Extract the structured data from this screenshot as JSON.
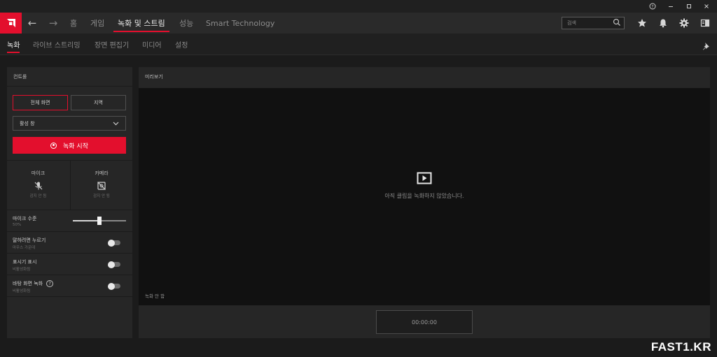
{
  "titlebar": {
    "controls": [
      "help-icon",
      "minimize-icon",
      "maximize-icon",
      "close-icon"
    ]
  },
  "topnav": {
    "home": "홈",
    "items": [
      "게임",
      "녹화 및 스트림",
      "성능",
      "Smart Technology"
    ],
    "active_index": 1,
    "search_placeholder": "검색",
    "tools": [
      "star-icon",
      "bell-icon",
      "gear-icon",
      "panel-icon"
    ]
  },
  "subnav": {
    "items": [
      "녹화",
      "라이브 스트리밍",
      "장면 편집기",
      "미디어",
      "설정"
    ],
    "active_index": 0
  },
  "left_panel": {
    "header": "컨트롤",
    "mode_full": "전체 화면",
    "mode_region": "지역",
    "active_mode": "전체 화면",
    "window_select": "활성 창",
    "record_button": "녹화 시작",
    "mic": {
      "label": "마이크",
      "status": "감지 안 됨"
    },
    "camera": {
      "label": "카메라",
      "status": "감지 안 됨"
    },
    "mic_level": {
      "label": "마이크 수준",
      "value_text": "50%",
      "value": 0.5
    },
    "push_to_talk": {
      "label": "말하려면 누르기",
      "sub": "마우스 가운데",
      "on": false
    },
    "show_indicator": {
      "label": "표시기 표시",
      "sub": "비활성화됨",
      "on": false
    },
    "desktop_record": {
      "label": "바탕 화면 녹화",
      "sub": "비활성화됨",
      "on": false
    }
  },
  "preview": {
    "header": "미리보기",
    "message": "아직 클립을 녹화하지 않았습니다.",
    "status": "녹화 안 함",
    "timer": "00:00:00"
  },
  "watermark": "FAST1.KR",
  "colors": {
    "accent": "#e30f2d"
  }
}
